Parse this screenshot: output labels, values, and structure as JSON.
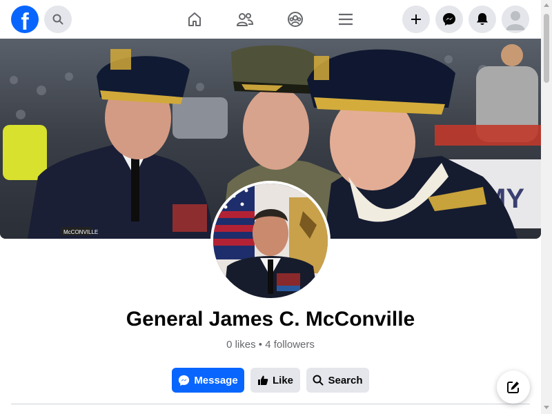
{
  "topbar": {
    "logo_letter": "f",
    "icons": {
      "search": "search-icon",
      "home": "home-icon",
      "friends": "friends-icon",
      "groups": "groups-icon",
      "menu": "menu-icon",
      "create": "plus-icon",
      "messenger": "messenger-icon",
      "notifications": "bell-icon",
      "account": "avatar-icon"
    }
  },
  "profile": {
    "name": "General James C. McConville",
    "stats": "0 likes • 4 followers",
    "cover_name_tag": "McCONVILLE",
    "cover_banner_text": "MY"
  },
  "actions": {
    "message_label": "Message",
    "like_label": "Like",
    "search_label": "Search"
  },
  "colors": {
    "brand": "#0866ff",
    "secondary_button": "#e4e6eb",
    "name_text": "#050505",
    "muted_text": "#65676b"
  }
}
